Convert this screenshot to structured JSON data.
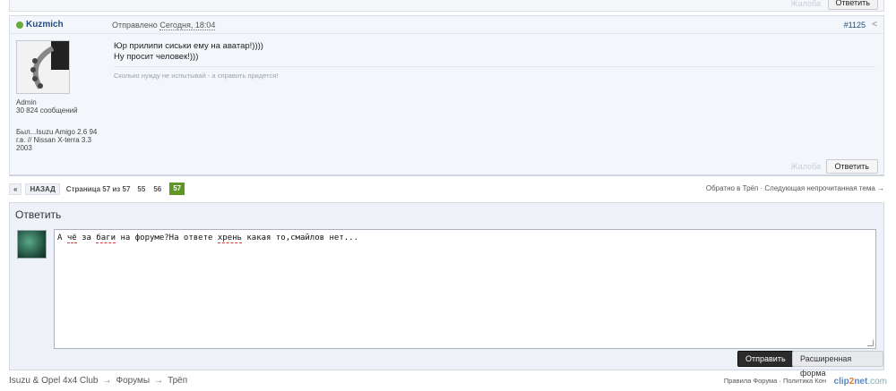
{
  "prev_post": {
    "complain_label": "Жалоба",
    "reply_label": "Ответить"
  },
  "post": {
    "username": "Kuzmich",
    "sent_label": "Отправлено",
    "sent_date": "Сегодня, 18:04",
    "post_number": "#1125",
    "message_lines": [
      "Юр прилипи сиськи ему на аватар!))))",
      "Ну просит человек!)))"
    ],
    "signature": "Сколько нужду не испытывай - а справить придется!",
    "user_role": "Admin",
    "user_posts": "30 824 сообщений",
    "user_cars": [
      "Был...Isuzu Amigo 2.6 94",
      "г.в. // Nissan X-terra 3.3",
      "2003"
    ],
    "complain_label": "Жалоба",
    "reply_label": "Ответить"
  },
  "pagination": {
    "prev_icon": "«",
    "back_label": "НАЗАД",
    "page_info": "Страница 57 из 57",
    "pages": [
      "55",
      "56"
    ],
    "current_page": "57",
    "right_links": "Обратно в Трёп · Следующая непрочитанная тема →"
  },
  "reply_box": {
    "title": "Ответить",
    "text_parts": [
      "А ",
      "чё",
      " за ",
      "баги",
      " на форуме?На ответе ",
      "хрень",
      " какая то,смайлов нет..."
    ],
    "send_label": "Отправить",
    "advanced_label": "Расширенная форма"
  },
  "breadcrumbs": [
    "Isuzu & Opel 4x4 Club",
    "Форумы",
    "Трёп"
  ],
  "breadcrumb_arrow": "→",
  "footer": {
    "links": "Правила Форума · Политика Кон",
    "clip_a": "clip",
    "clip_b": "2",
    "clip_c": "net",
    "clip_d": ".com"
  },
  "icons": {
    "share": "share-icon",
    "online": "online-dot-icon"
  },
  "colors": {
    "accent": "#1e4d86",
    "online": "#6aab3e",
    "current_page": "#5f9725"
  }
}
